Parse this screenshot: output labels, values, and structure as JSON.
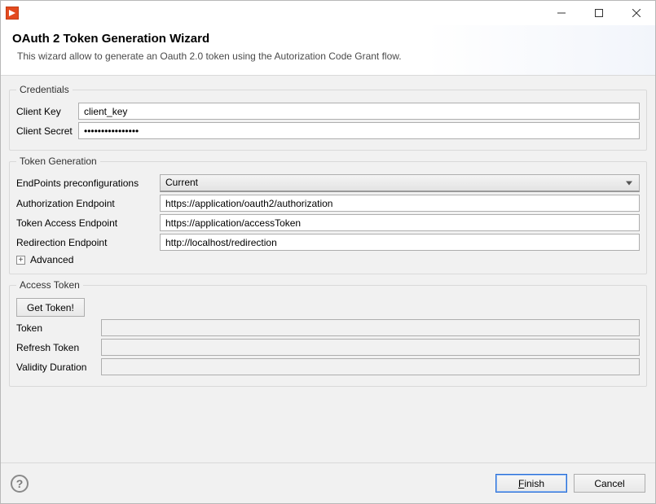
{
  "header": {
    "title": "OAuth 2 Token Generation Wizard",
    "subtitle": "This wizard allow to generate an Oauth 2.0 token using the Autorization Code Grant flow."
  },
  "credentials": {
    "legend": "Credentials",
    "client_key_label": "Client Key",
    "client_key_value": "client_key",
    "client_secret_label": "Client Secret",
    "client_secret_value": "••••••••••••••••"
  },
  "token_generation": {
    "legend": "Token Generation",
    "preconfig_label": "EndPoints preconfigurations",
    "preconfig_value": "Current",
    "auth_endpoint_label": "Authorization Endpoint",
    "auth_endpoint_value": "https://application/oauth2/authorization",
    "token_endpoint_label": "Token Access Endpoint",
    "token_endpoint_value": "https://application/accessToken",
    "redirect_endpoint_label": "Redirection Endpoint",
    "redirect_endpoint_value": "http://localhost/redirection",
    "advanced_label": "Advanced"
  },
  "access_token": {
    "legend": "Access Token",
    "get_token_button": "Get Token!",
    "token_label": "Token",
    "token_value": "",
    "refresh_label": "Refresh Token",
    "refresh_value": "",
    "validity_label": "Validity Duration",
    "validity_value": ""
  },
  "footer": {
    "finish": "Finish",
    "cancel": "Cancel"
  }
}
